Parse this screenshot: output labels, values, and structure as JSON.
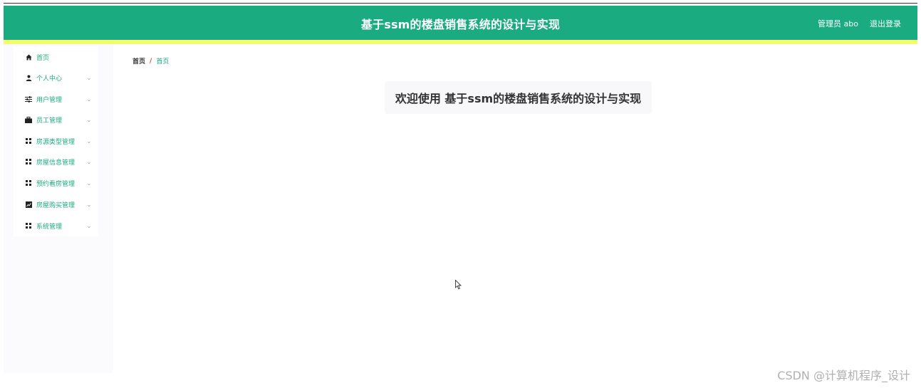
{
  "header": {
    "title": "基于ssm的楼盘销售系统的设计与实现",
    "user_label": "管理员 abo",
    "logout_label": "退出登录"
  },
  "sidebar": {
    "items": [
      {
        "label": "首页",
        "icon": "home-icon",
        "has_submenu": false
      },
      {
        "label": "个人中心",
        "icon": "user-icon",
        "has_submenu": true
      },
      {
        "label": "用户管理",
        "icon": "sliders-icon",
        "has_submenu": true
      },
      {
        "label": "员工管理",
        "icon": "briefcase-icon",
        "has_submenu": true
      },
      {
        "label": "房源类型管理",
        "icon": "grid-icon",
        "has_submenu": true
      },
      {
        "label": "房屋信息管理",
        "icon": "grid-icon",
        "has_submenu": true
      },
      {
        "label": "预约看房管理",
        "icon": "grid-icon",
        "has_submenu": true
      },
      {
        "label": "房屋购买管理",
        "icon": "chart-icon",
        "has_submenu": true
      },
      {
        "label": "系统管理",
        "icon": "grid-icon",
        "has_submenu": true
      }
    ]
  },
  "breadcrumb": {
    "home": "首页",
    "separator": "/",
    "current": "首页"
  },
  "main": {
    "welcome": "欢迎使用 基于ssm的楼盘销售系统的设计与实现"
  },
  "watermark": "CSDN @计算机程序_设计",
  "colors": {
    "header_bg": "#1aab80",
    "accent_bar": "#f7f96e",
    "menu_text": "#1aab80"
  }
}
